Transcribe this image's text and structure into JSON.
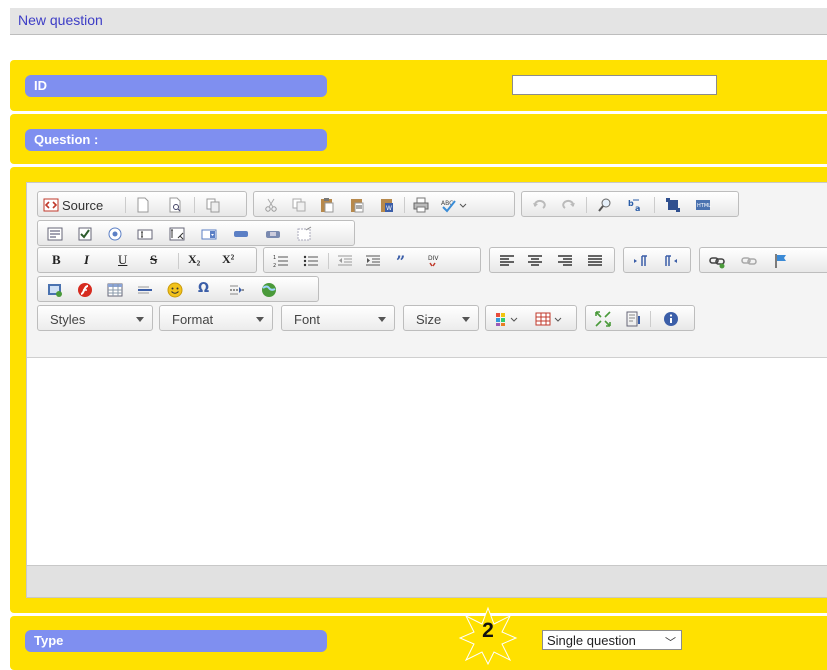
{
  "header": {
    "title": "New question"
  },
  "fields": {
    "id_label": "ID",
    "id_value": "",
    "question_label": "Question :",
    "type_label": "Type",
    "type_value": "Single question",
    "step_badge": "2"
  },
  "editor": {
    "source_label": "Source",
    "text_buttons": {
      "bold": "B",
      "italic": "I",
      "underline": "U",
      "strike": "S",
      "subscript": "X₂",
      "superscript": "X²"
    },
    "combos": [
      {
        "name": "styles",
        "label": "Styles"
      },
      {
        "name": "format",
        "label": "Format"
      },
      {
        "name": "font",
        "label": "Font"
      },
      {
        "name": "size",
        "label": "Size"
      }
    ],
    "special_char": "Ω"
  },
  "colors": {
    "panel_yellow": "#ffe100",
    "label_pill": "#7f8ff0",
    "header_title": "#3d3dc6"
  }
}
